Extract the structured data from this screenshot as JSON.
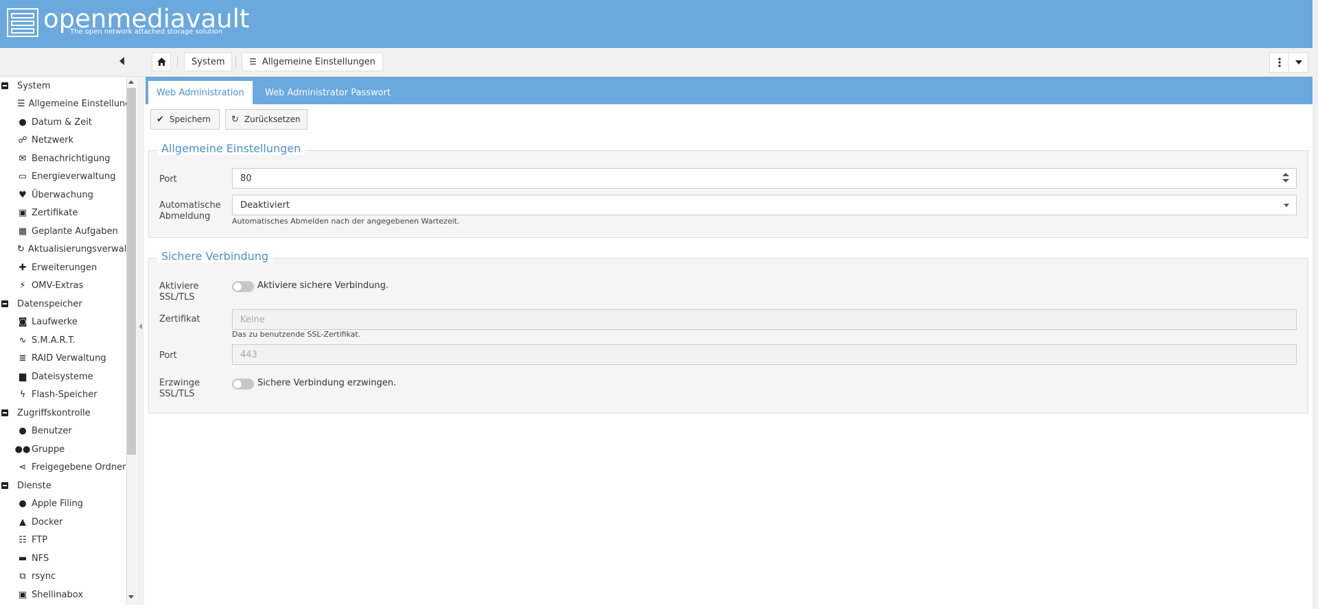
{
  "header": {
    "logo_text": "openmediavault",
    "tagline": "The open network attached storage solution"
  },
  "breadcrumb": {
    "home": "home",
    "system": "System",
    "current": "Allgemeine Einstellungen"
  },
  "sidebar": {
    "groups": [
      {
        "label": "System",
        "items": [
          {
            "label": "Allgemeine Einstellung",
            "icon": "sliders-icon"
          },
          {
            "label": "Datum & Zeit",
            "icon": "clock-icon"
          },
          {
            "label": "Netzwerk",
            "icon": "network-icon"
          },
          {
            "label": "Benachrichtigung",
            "icon": "mail-icon"
          },
          {
            "label": "Energieverwaltung",
            "icon": "battery-icon"
          },
          {
            "label": "Überwachung",
            "icon": "heartbeat-icon"
          },
          {
            "label": "Zertifikate",
            "icon": "certificate-icon"
          },
          {
            "label": "Geplante Aufgaben",
            "icon": "calendar-clock-icon"
          },
          {
            "label": "Aktualisierungsverwalt",
            "icon": "refresh-icon"
          },
          {
            "label": "Erweiterungen",
            "icon": "puzzle-icon"
          },
          {
            "label": "OMV-Extras",
            "icon": "plug-icon"
          }
        ]
      },
      {
        "label": "Datenspeicher",
        "items": [
          {
            "label": "Laufwerke",
            "icon": "harddisk-icon"
          },
          {
            "label": "S.M.A.R.T.",
            "icon": "pulse-icon"
          },
          {
            "label": "RAID Verwaltung",
            "icon": "database-icon"
          },
          {
            "label": "Dateisysteme",
            "icon": "folders-icon"
          },
          {
            "label": "Flash-Speicher",
            "icon": "flash-icon"
          }
        ]
      },
      {
        "label": "Zugriffskontrolle",
        "items": [
          {
            "label": "Benutzer",
            "icon": "user-icon"
          },
          {
            "label": "Gruppe",
            "icon": "group-icon"
          },
          {
            "label": "Freigegebene Ordner",
            "icon": "share-icon"
          }
        ]
      },
      {
        "label": "Dienste",
        "items": [
          {
            "label": "Apple Filing",
            "icon": "apple-icon"
          },
          {
            "label": "Docker",
            "icon": "docker-icon"
          },
          {
            "label": "FTP",
            "icon": "server-icon"
          },
          {
            "label": "NFS",
            "icon": "monitor-icon"
          },
          {
            "label": "rsync",
            "icon": "sync-files-icon"
          },
          {
            "label": "Shellinabox",
            "icon": "terminal-icon"
          }
        ]
      }
    ]
  },
  "tabs": [
    {
      "label": "Web Administration",
      "active": true
    },
    {
      "label": "Web Administrator Passwort",
      "active": false
    }
  ],
  "toolbar": {
    "save": "Speichern",
    "reset": "Zurücksetzen"
  },
  "general": {
    "legend": "Allgemeine Einstellungen",
    "port_label": "Port",
    "port_value": "80",
    "autologout_label_1": "Automatische",
    "autologout_label_2": "Abmeldung",
    "autologout_value": "Deaktiviert",
    "autologout_hint": "Automatisches Abmelden nach der angegebenen Wartezeit."
  },
  "secure": {
    "legend": "Sichere Verbindung",
    "enable_label_1": "Aktiviere",
    "enable_label_2": "SSL/TLS",
    "enable_text": "Aktiviere sichere Verbindung.",
    "cert_label": "Zertifikat",
    "cert_placeholder": "Keine",
    "cert_hint": "Das zu benutzende SSL-Zertifikat.",
    "port_label": "Port",
    "port_placeholder": "443",
    "force_label_1": "Erzwinge",
    "force_label_2": "SSL/TLS",
    "force_text": "Sichere Verbindung erzwingen."
  }
}
